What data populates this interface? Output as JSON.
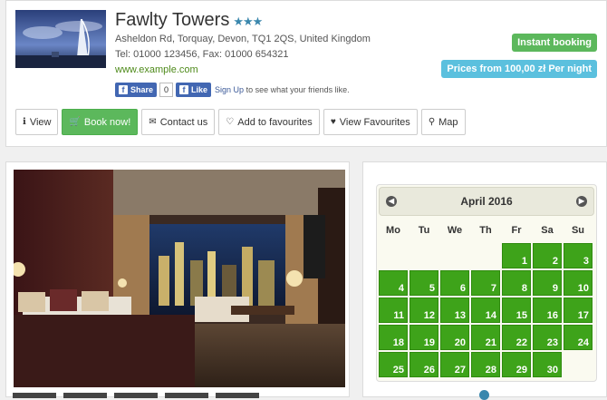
{
  "hotel": {
    "name": "Fawlty Towers",
    "stars": "★★★",
    "address": "Asheldon Rd, Torquay, Devon, TQ1 2QS, United Kingdom",
    "phone": "Tel: 01000 123456, Fax: 01000 654321",
    "website": "www.example.com"
  },
  "facebook": {
    "share_label": "Share",
    "share_count": "0",
    "like_label": "Like",
    "signup_label": "Sign Up",
    "signup_text": " to see what your friends like."
  },
  "badges": {
    "instant": "Instant booking",
    "price": "Prices from 100,00 zł  Per night"
  },
  "actions": {
    "view": "View",
    "book": "Book now!",
    "contact": "Contact us",
    "add_fav": "Add to favourites",
    "view_fav": "View Favourites",
    "map": "Map"
  },
  "calendar": {
    "month": "April 2016",
    "weekdays": [
      "Mo",
      "Tu",
      "We",
      "Th",
      "Fr",
      "Sa",
      "Su"
    ],
    "leading_blanks": 4,
    "days": [
      "1",
      "2",
      "3",
      "4",
      "5",
      "6",
      "7",
      "8",
      "9",
      "10",
      "11",
      "12",
      "13",
      "14",
      "15",
      "16",
      "17",
      "18",
      "19",
      "20",
      "21",
      "22",
      "23",
      "24",
      "25",
      "26",
      "27",
      "28",
      "29",
      "30"
    ]
  },
  "colors": {
    "available_day": "#3ea31a",
    "instant_badge": "#5cb85c",
    "price_badge": "#5bc0de",
    "star": "#3a87ad"
  }
}
